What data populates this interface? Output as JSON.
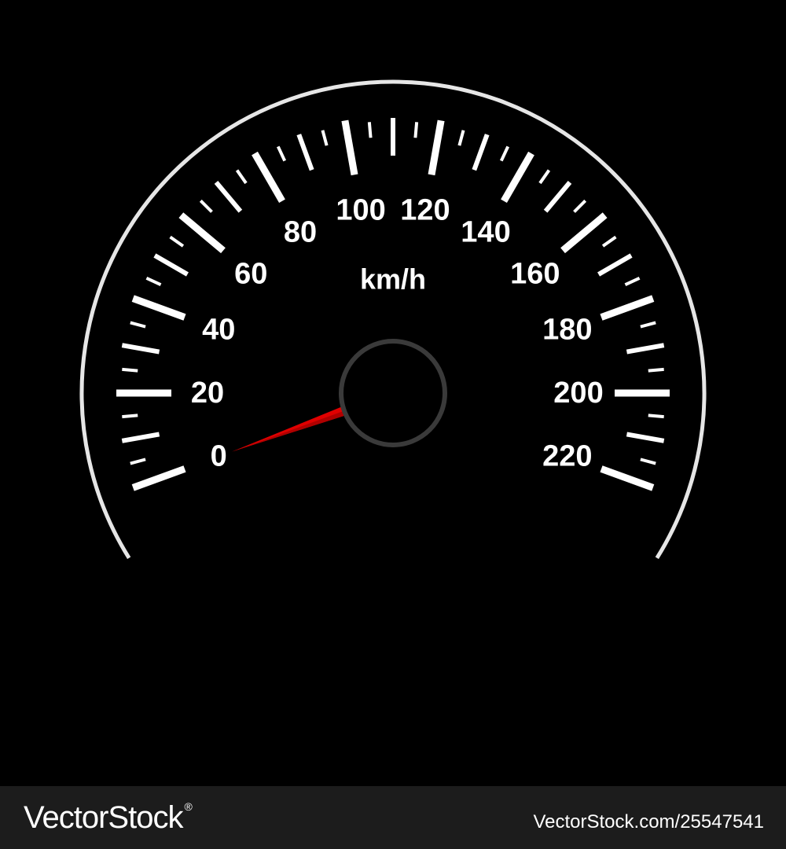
{
  "gauge": {
    "unit": "km/h",
    "min": 0,
    "max": 220,
    "major_step": 20,
    "minor_per_major": 4,
    "labels": [
      "0",
      "20",
      "40",
      "60",
      "80",
      "100",
      "120",
      "140",
      "160",
      "180",
      "200",
      "220"
    ],
    "needle_value": 0,
    "colors": {
      "background": "#000000",
      "ticks": "#ffffff",
      "rim": "#e6e6e6",
      "needle": "#e00000",
      "hub_ring": "#3a3a3a"
    }
  },
  "footer": {
    "brand": "VectorStock",
    "brand_mark": "®",
    "stock_id": "VectorStock.com/25547541",
    "background": "#1c1c1c"
  }
}
